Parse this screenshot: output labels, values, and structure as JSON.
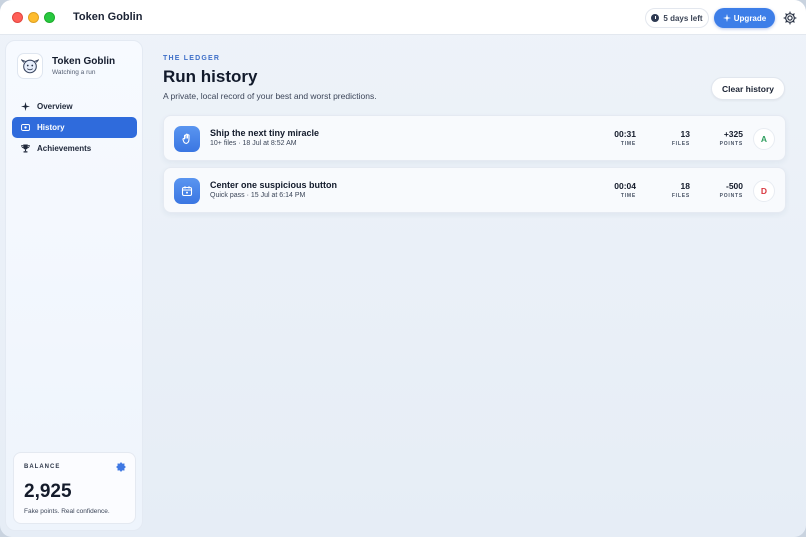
{
  "window": {
    "title": "Token Goblin"
  },
  "titlebar": {
    "trial_text": "5 days left",
    "upgrade_label": "Upgrade"
  },
  "sidebar": {
    "brand": {
      "name": "Token Goblin",
      "status": "Watching a run"
    },
    "items": [
      {
        "label": "Overview",
        "icon": "sparkle-icon",
        "active": false
      },
      {
        "label": "History",
        "icon": "history-icon",
        "active": true
      },
      {
        "label": "Achievements",
        "icon": "trophy-icon",
        "active": false
      }
    ],
    "balance": {
      "label": "BALANCE",
      "value": "2,925",
      "caption": "Fake points. Real confidence."
    }
  },
  "main": {
    "eyebrow": "THE LEDGER",
    "title": "Run history",
    "subtitle": "A private, local record of your best and worst predictions.",
    "clear_label": "Clear history",
    "stat_labels": {
      "time": "TIME",
      "files": "FILES",
      "points": "POINTS"
    },
    "runs": [
      {
        "title": "Ship the next tiny miracle",
        "meta": "10+ files · 18 Jul at 8:52 AM",
        "time": "00:31",
        "files": "13",
        "points": "+325",
        "grade": "A",
        "grade_color": "#2f9e5e",
        "icon": "hand-icon"
      },
      {
        "title": "Center one suspicious button",
        "meta": "Quick pass · 15 Jul at 6:14 PM",
        "time": "00:04",
        "files": "18",
        "points": "-500",
        "grade": "D",
        "grade_color": "#d9363e",
        "icon": "calendar-icon"
      }
    ]
  },
  "colors": {
    "accent": "#2f6bdc",
    "upgrade": "#3d7ee8",
    "eyebrow": "#3e6fc8"
  }
}
